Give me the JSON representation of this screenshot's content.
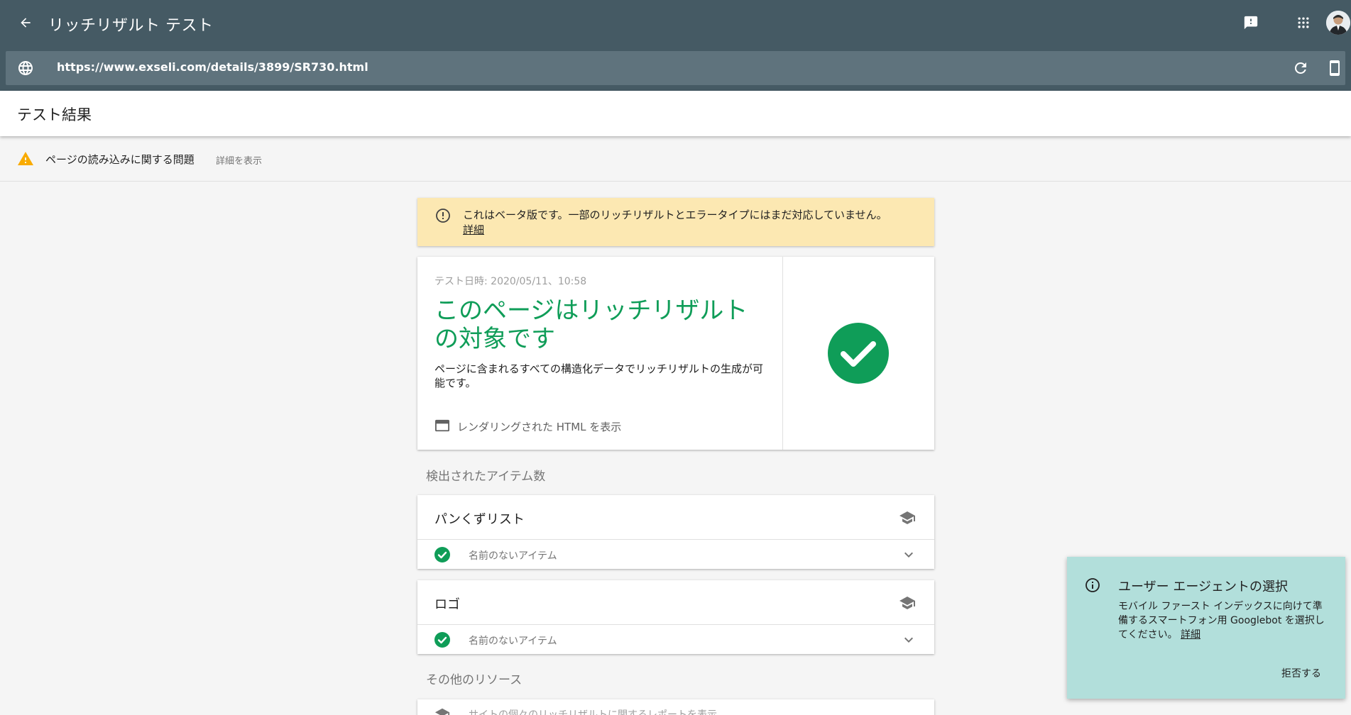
{
  "appbar": {
    "title": "リッチリザルト テスト",
    "url": "https://www.exseli.com/details/3899/SR730.html",
    "icons": {
      "back": "arrow-back-icon",
      "feedback": "feedback-icon",
      "apps": "apps-grid-icon",
      "globe": "globe-icon",
      "refresh": "refresh-icon",
      "device": "smartphone-icon"
    }
  },
  "results": {
    "title": "テスト結果"
  },
  "issue": {
    "text": "ページの読み込みに関する問題",
    "link": "詳細を表示"
  },
  "beta": {
    "text": "これはベータ版です。一部のリッチリザルトとエラータイプにはまだ対応していません。",
    "link": "詳細"
  },
  "result": {
    "date": "テスト日時: 2020/05/11、10:58",
    "headline": "このページはリッチリザルトの対象です",
    "description": "ページに含まれるすべての構造化データでリッチリザルトの生成が可能です。",
    "html_link": "レンダリングされた HTML を表示"
  },
  "detected": {
    "label": "検出されたアイテム数",
    "items": [
      {
        "title": "パンくずリスト",
        "row": "名前のないアイテム"
      },
      {
        "title": "ロゴ",
        "row": "名前のないアイテム"
      }
    ]
  },
  "other": {
    "label": "その他のリソース",
    "row": "サイトの個々のリッチリザルトに関するレポートを表示"
  },
  "ua_panel": {
    "title": "ユーザー エージェントの選択",
    "body": "モバイル ファースト インデックスに向けて準備するスマートフォン用 Googlebot を選択してください。",
    "link": "詳細",
    "dismiss": "拒否する"
  },
  "colors": {
    "appbar": "#455a64",
    "success": "#0f9d58",
    "warning": "#f9ab00",
    "beta_banner": "#fce8b2",
    "ua_panel": "#b2dfdb"
  }
}
